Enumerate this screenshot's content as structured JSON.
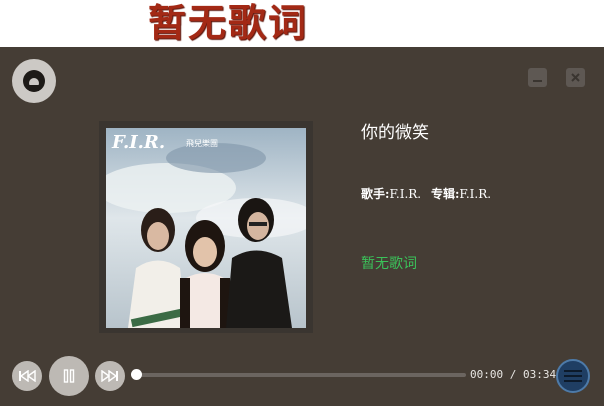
{
  "banner": {
    "text": "暂无歌词"
  },
  "song": {
    "title": "你的微笑",
    "artist_label": "歌手:",
    "artist": "F.I.R.",
    "album_label": "专辑:",
    "album": "F.I.R.",
    "lyric_status": "暂无歌词"
  },
  "cover": {
    "logo_text": "F.I.R.",
    "sub_text": "飛兒樂團"
  },
  "playback": {
    "current_time": "00:00",
    "separator": "/",
    "total_time": "03:34",
    "progress_fraction": 0.0,
    "state": "playing"
  },
  "icons": {
    "logo": "logo-icon",
    "minimize": "minimize-icon",
    "close": "close-icon",
    "previous": "previous-icon",
    "pause": "pause-icon",
    "next": "next-icon",
    "menu": "menu-icon"
  },
  "colors": {
    "player_bg": "#453d35",
    "banner_text": "#a32915",
    "lyric_status": "#3bc25a",
    "menu_button": "#1f3e63"
  }
}
